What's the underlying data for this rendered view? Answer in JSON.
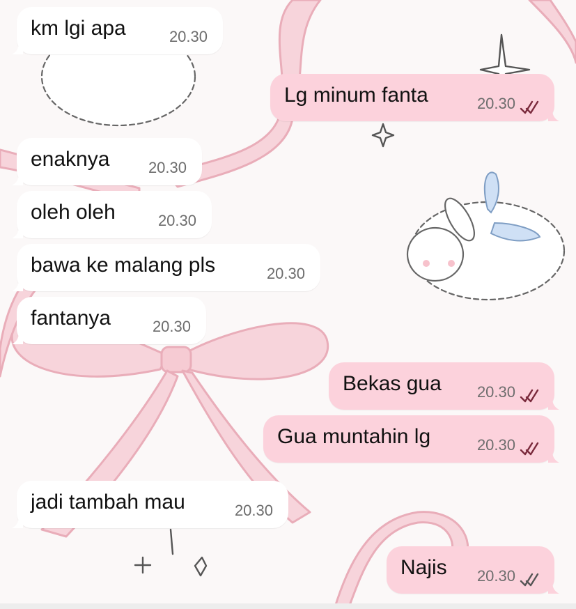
{
  "messages": [
    {
      "direction": "incoming",
      "text": "km lgi apa",
      "time": "20.30"
    },
    {
      "direction": "outgoing",
      "text": "Lg minum fanta",
      "time": "20.30",
      "status": "read"
    },
    {
      "direction": "incoming",
      "text": "enaknya",
      "time": "20.30"
    },
    {
      "direction": "incoming",
      "text": "oleh oleh",
      "time": "20.30"
    },
    {
      "direction": "incoming",
      "text": "bawa ke malang pls",
      "time": "20.30"
    },
    {
      "direction": "incoming",
      "text": "fantanya",
      "time": "20.30"
    },
    {
      "direction": "outgoing",
      "text": "Bekas gua",
      "time": "20.30",
      "status": "read"
    },
    {
      "direction": "outgoing",
      "text": "Gua muntahin lg",
      "time": "20.30",
      "status": "read"
    },
    {
      "direction": "incoming",
      "text": "jadi tambah mau",
      "time": "20.30"
    },
    {
      "direction": "outgoing",
      "text": "Najis",
      "time": "20.30",
      "status": "delivered"
    }
  ],
  "colors": {
    "incoming_bubble": "#ffffff",
    "outgoing_bubble": "#fcd2dc",
    "read_check": "#7a2a3c",
    "delivered_check": "#555555",
    "ribbon": "#f4c4cc"
  },
  "wallpaper": {
    "theme": "pink ribbons and winged bunnies"
  }
}
